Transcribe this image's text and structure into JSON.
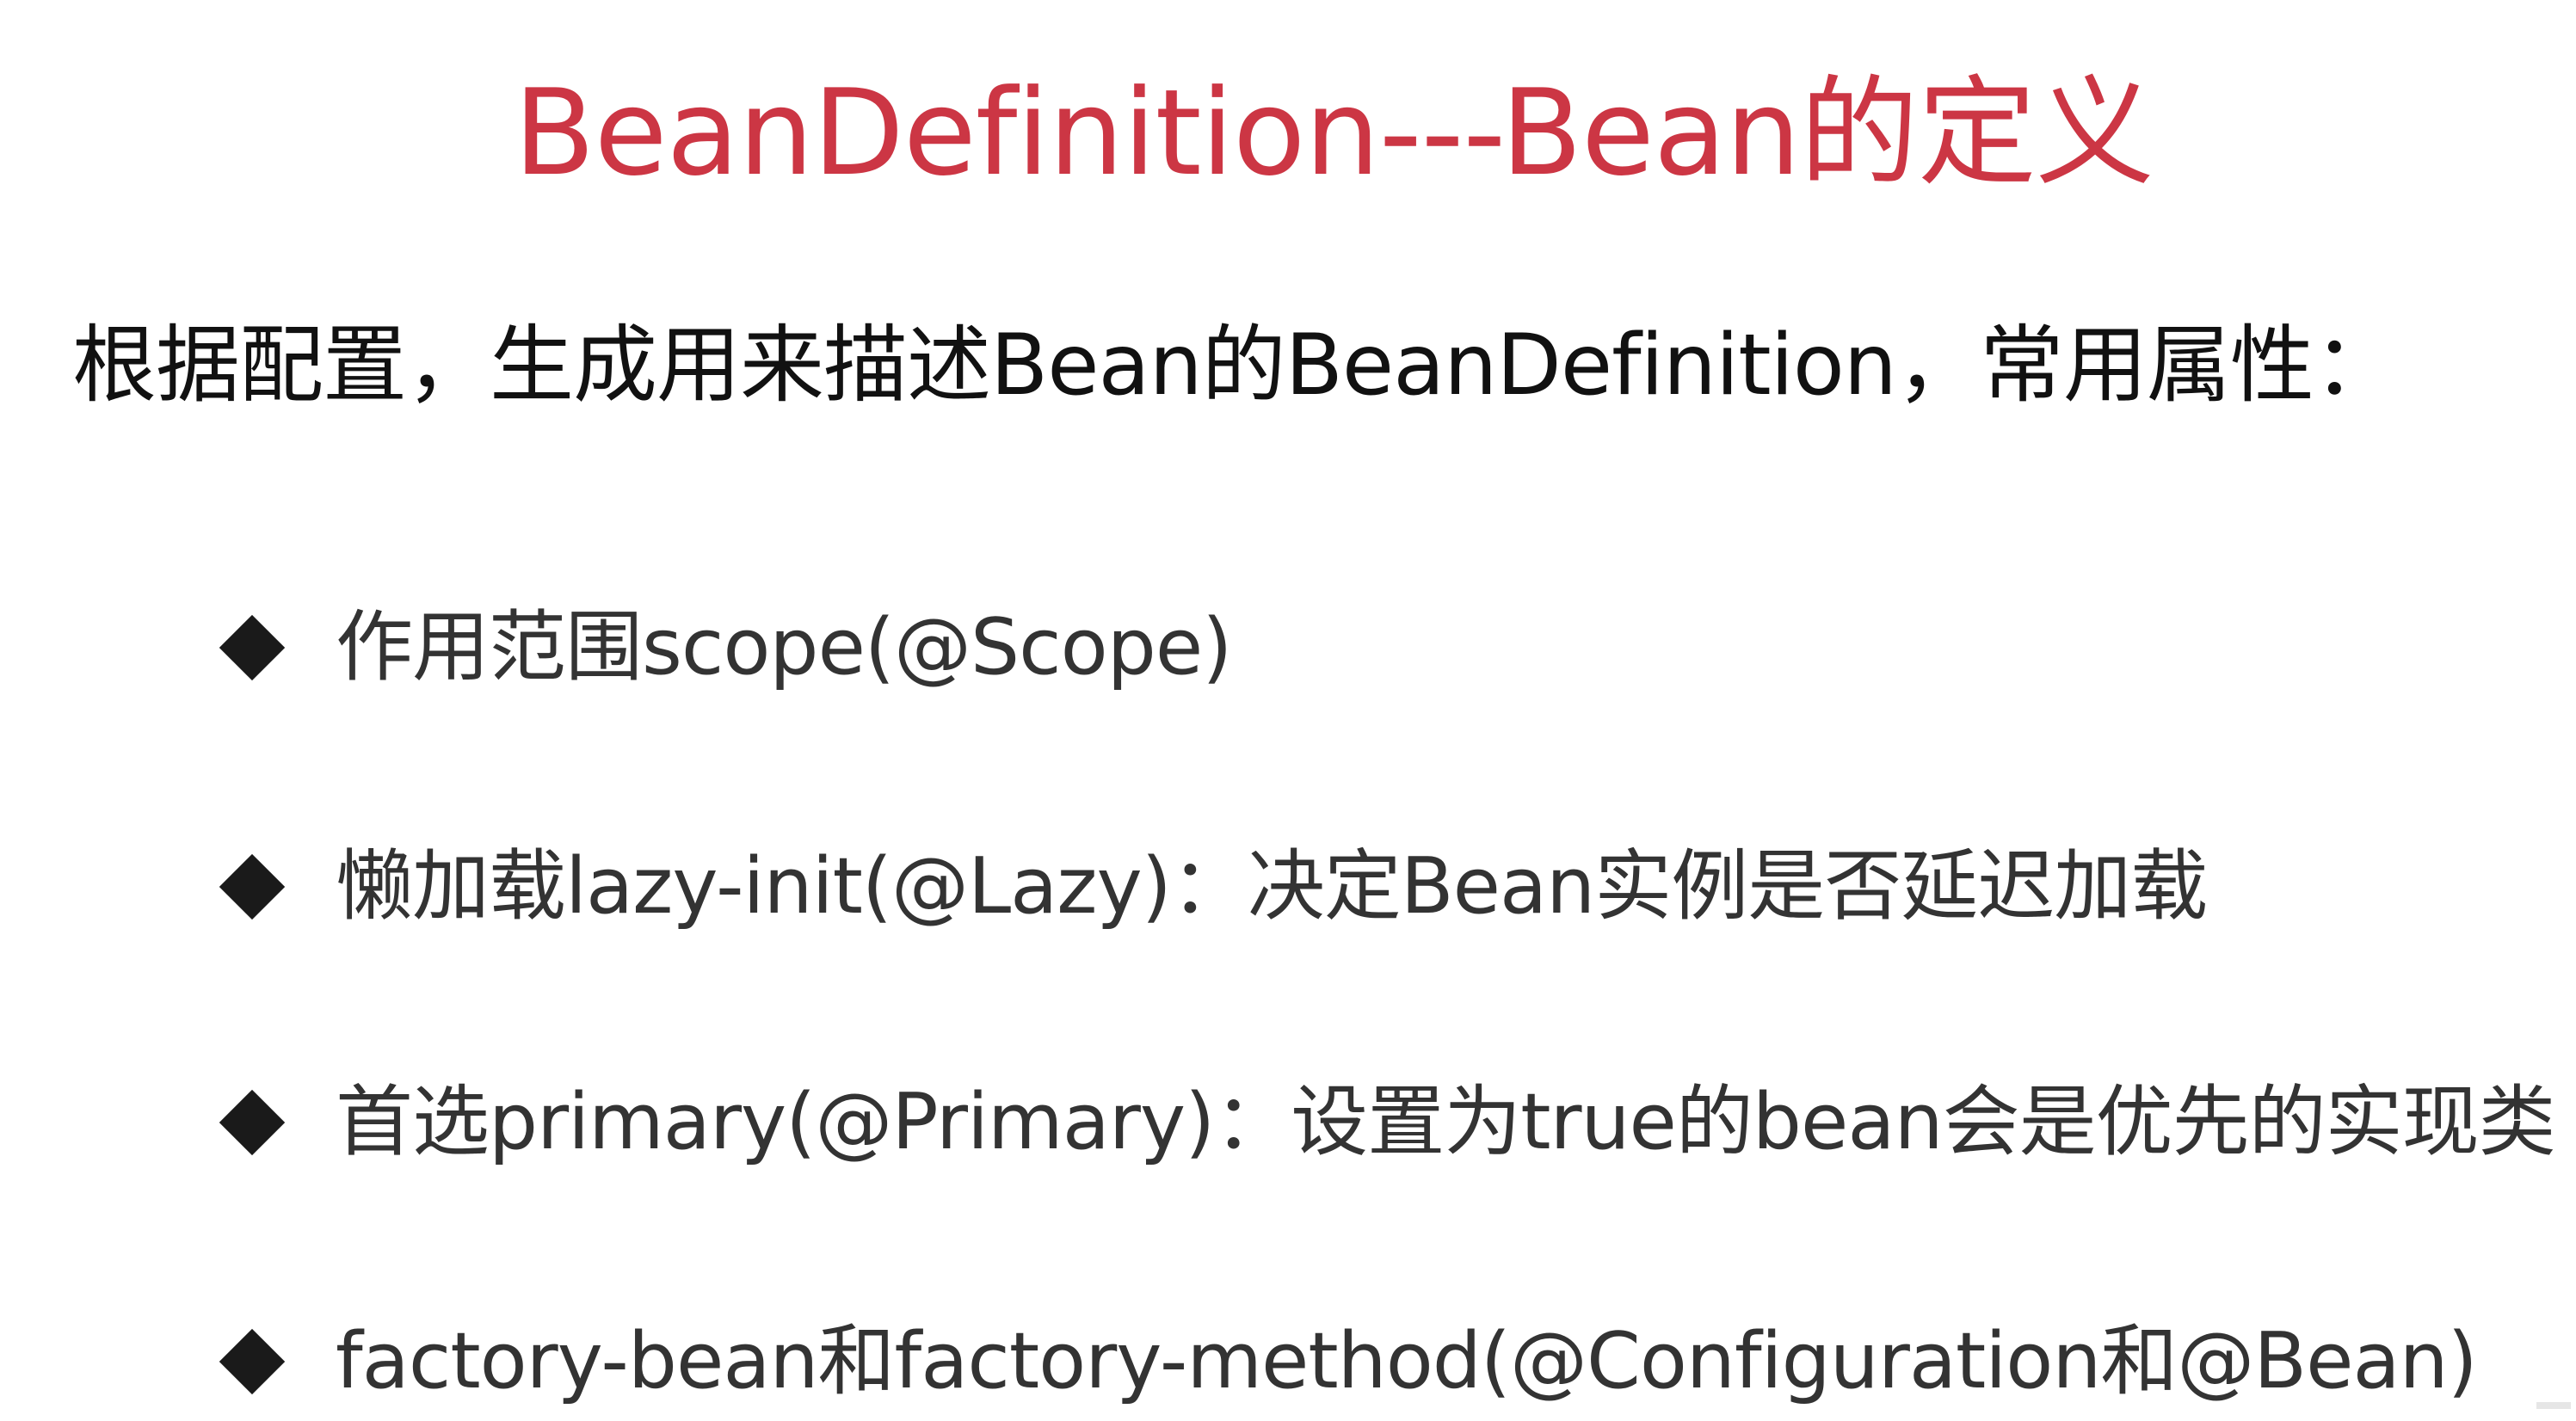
{
  "slide": {
    "title": "BeanDefinition---Bean的定义",
    "title_color": "#cc3644",
    "intro": "根据配置，生成用来描述Bean的BeanDefinition，常用属性：",
    "bullets": [
      {
        "icon": "diamond-bullet-icon",
        "text": "作用范围scope(@Scope)"
      },
      {
        "icon": "diamond-bullet-icon",
        "text": "懒加载lazy-init(@Lazy)：决定Bean实例是否延迟加载"
      },
      {
        "icon": "diamond-bullet-icon",
        "text": "首选primary(@Primary)：设置为true的bean会是优先的实现类"
      },
      {
        "icon": "diamond-bullet-icon",
        "text": "factory-bean和factory-method(@Configuration和@Bean)"
      }
    ]
  }
}
